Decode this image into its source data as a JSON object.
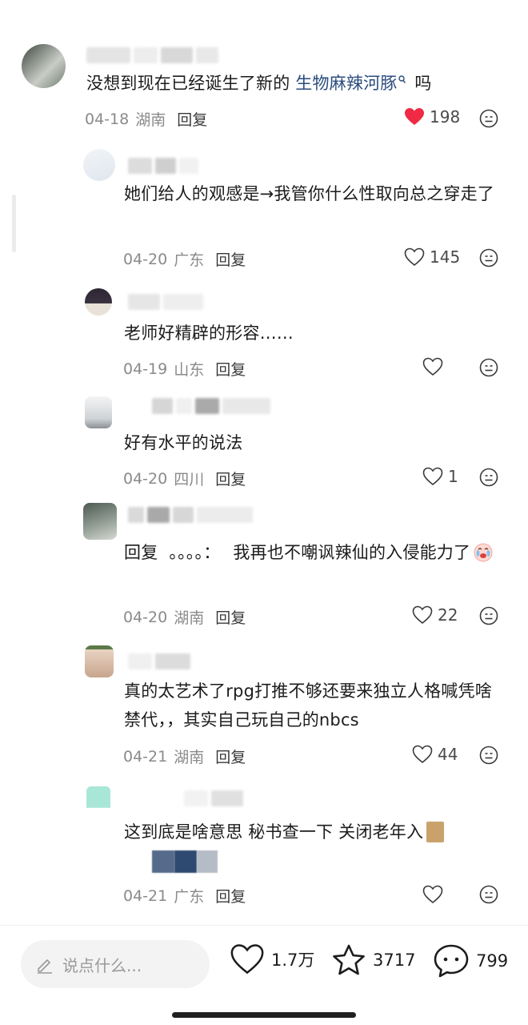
{
  "comments": [
    {
      "text_pre": "没想到现在已经诞生了新的 ",
      "link": "生物麻辣河豚",
      "link_icon": "search-icon",
      "text_post": " 吗",
      "date": "04-18",
      "region": "湖南",
      "reply": "回复",
      "likes": "198",
      "liked": true
    },
    {
      "text": "她们给人的观感是→我管你什么性取向总之穿走了",
      "date": "04-20",
      "region": "广东",
      "reply": "回复",
      "likes": "145"
    },
    {
      "text": "老师好精辟的形容……",
      "date": "04-19",
      "region": "山东",
      "reply": "回复",
      "likes": ""
    },
    {
      "text": "好有水平的说法",
      "date": "04-20",
      "region": "四川",
      "reply": "回复",
      "likes": "1"
    },
    {
      "reply_prefix": "回复",
      "reply_to": "。。。。：",
      "text": "我再也不嘲讽辣仙的入侵能力了",
      "emoji": "crying-face-icon",
      "date": "04-20",
      "region": "湖南",
      "reply": "回复",
      "likes": "22"
    },
    {
      "text": "真的太艺术了rpg打推不够还要来独立人格喊凭啥禁代，，其实自己玩自己的nbcs",
      "date": "04-21",
      "region": "湖南",
      "reply": "回复",
      "likes": "44"
    },
    {
      "text": "这到底是啥意思 秘书查一下 关闭老年入",
      "date": "04-21",
      "region": "广东",
      "reply": "回复",
      "likes": ""
    }
  ],
  "bottom_bar": {
    "placeholder": "说点什么...",
    "likes": "1.7万",
    "stars": "3717",
    "comments": "799"
  },
  "colors": {
    "liked": "#f02a44",
    "link": "#2b4c7e",
    "meta": "#8a8a8a"
  }
}
